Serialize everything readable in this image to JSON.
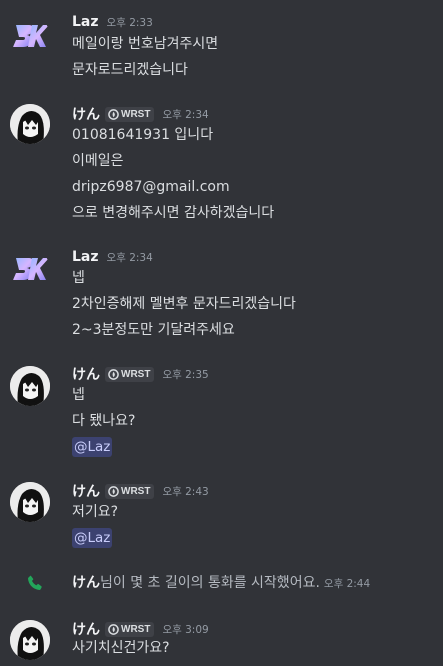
{
  "users": {
    "laz": {
      "name": "Laz"
    },
    "ken": {
      "name": "けん",
      "tag": "WRST"
    }
  },
  "messages": [
    {
      "author": "Laz",
      "time": "오후 2:33",
      "lines": [
        "메일이랑 번호남겨주시면",
        "문자로드리겠습니다"
      ]
    },
    {
      "author": "けん",
      "tag": "WRST",
      "time": "오후 2:34",
      "lines": [
        "01081641931 입니다",
        "이메일은",
        "dripz6987@gmail.com",
        "으로 변경해주시면 감사하겠습니다"
      ]
    },
    {
      "author": "Laz",
      "time": "오후 2:34",
      "lines": [
        "넵",
        "2차인증해제 멜변후 문자드리겠습니다",
        "2~3분정도만 기달려주세요"
      ]
    },
    {
      "author": "けん",
      "tag": "WRST",
      "time": "오후 2:35",
      "lines": [
        "넵",
        "다 됐나요?"
      ],
      "mention": "@Laz"
    },
    {
      "author": "けん",
      "tag": "WRST",
      "time": "오후 2:43",
      "lines": [
        "저기요?"
      ],
      "mention": "@Laz"
    },
    {
      "author": "けん",
      "tag": "WRST",
      "time": "오후 3:09",
      "lines": [
        "사기치신건가요?"
      ]
    }
  ],
  "system_call": {
    "name": "けん",
    "text": "님이 몇 초 길이의 통화를 시작했어요.",
    "time": "오후 2:44",
    "icon": "phone-icon",
    "icon_color": "#23a55a"
  },
  "colors": {
    "background": "#313338",
    "mention_bg": "#3c4270",
    "mention_text": "#c9cdfb",
    "timestamp": "#949ba4"
  }
}
